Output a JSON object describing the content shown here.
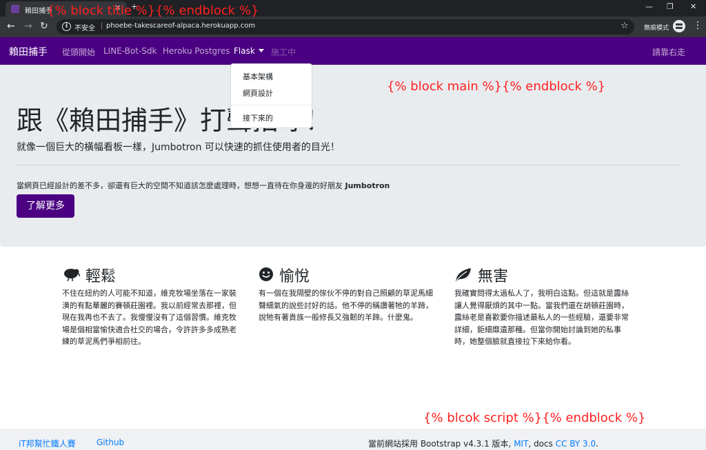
{
  "browser": {
    "tab_title": "賴田捕手",
    "address_security": "不安全",
    "url": "phoebe-takescareof-alpaca.herokuapp.com",
    "incognito_label": "無痕模式"
  },
  "navbar": {
    "brand": "賴田捕手",
    "links": [
      "從頭開始",
      "LINE-Bot-Sdk",
      "Heroku Postgres",
      "Flask",
      "施工中"
    ],
    "right_link": "請靠右走",
    "accent_color": "#4b0082"
  },
  "dropdown": {
    "items": [
      "基本架構",
      "網頁設計",
      "接下來的"
    ]
  },
  "template_annotations": {
    "title": "{% block title %}{% endblock %}",
    "main": "{% block main %}{% endblock %}",
    "script": "{% blcok script %}{% endblock %}"
  },
  "jumbotron": {
    "heading": "跟《賴田捕手》打聲招呼！",
    "lead": "就像一個巨大的橫幅看板一樣，Jumbotron 可以快速的抓住使用者的目光！",
    "body_prefix": "當網頁已經設計的差不多，卻還有巨大的空間不知道該怎麼處理時，想想一直待在你身邊的好朋友 ",
    "body_strong": "Jumbotron",
    "button": "了解更多"
  },
  "features": [
    {
      "icon": "kiwi-bird-icon",
      "title": "輕鬆",
      "body": "不住在紐約的人可能不知道，維克牧場坐落在一家裝潢的有點華麗的賽頓莊園裡。我以前經常去那裡，但現在我再也不去了。我慢慢沒有了這個習慣。維克牧場是個相當愉快適合社交的場合，令許許多多成熟老練的草泥馬們爭相前往。"
    },
    {
      "icon": "smile-icon",
      "title": "愉悅",
      "body": "有一個在我隔壁的傢伙不停的對自己照顧的草泥馬細聲細氣的說些討好的話。他不停的稱讚著牠的羊蹄，說牠有著貴族一般修長又強韌的羊蹄。什麼鬼。"
    },
    {
      "icon": "leaf-icon",
      "title": "無害",
      "body": "我確實問得太過私人了，我明白這點。但這就是露絲讓人覺得厭煩的其中一點。當我們還在胡頓莊園時，露絲老是喜歡要你描述最私人的一些經驗，還要非常詳細，鉅細靡遺那種。但當你開始討論到她的私事時，她整個臉就直接拉下來給你看。"
    }
  ],
  "footer": {
    "link1": "iT邦幫忙鐵人賽",
    "link2": "Github",
    "credit_prefix": "當前網站採用 Bootstrap v4.3.1 版本, ",
    "mit": "MIT",
    "credit_mid": ", docs ",
    "cc": "CC BY 3.0",
    "credit_suffix": "."
  }
}
